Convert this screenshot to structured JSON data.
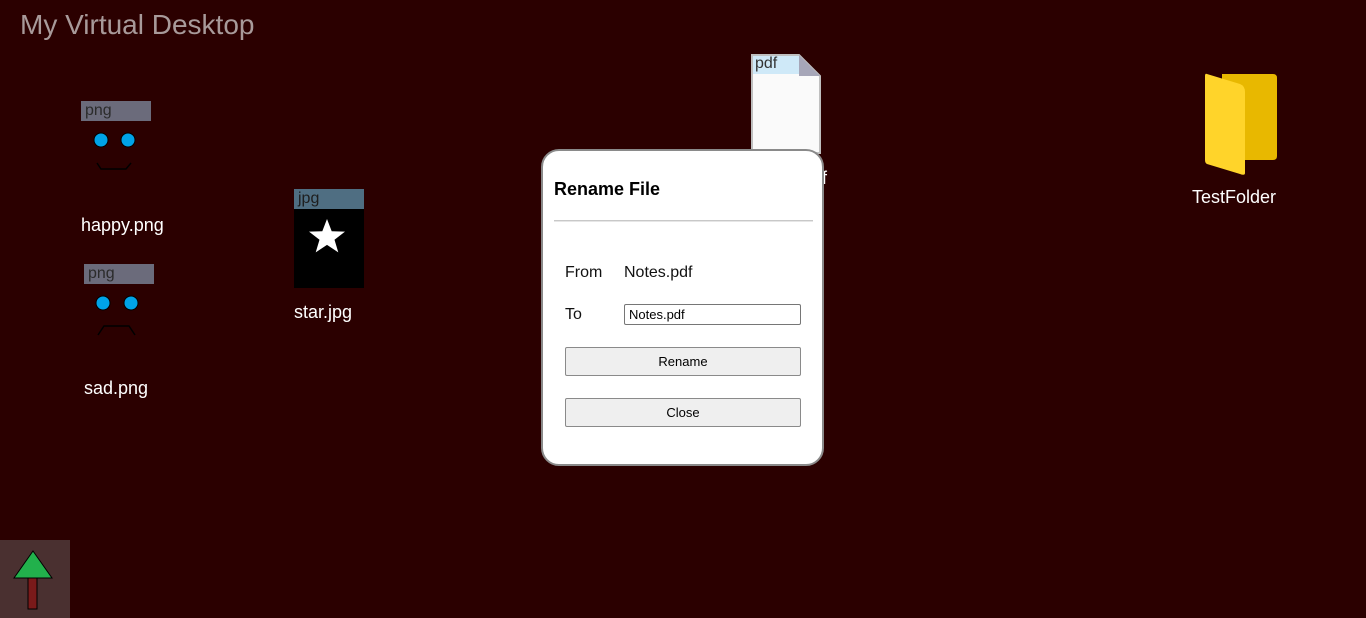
{
  "desktop": {
    "title": "My Virtual Desktop"
  },
  "icons": {
    "happy": {
      "ext": "png",
      "label": "happy.png",
      "icon": "happy-face-icon"
    },
    "sad": {
      "ext": "png",
      "label": "sad.png",
      "icon": "sad-face-icon"
    },
    "star": {
      "ext": "jpg",
      "label": "star.jpg",
      "icon": "star-icon"
    },
    "notes": {
      "ext": "pdf",
      "label_tail": "f",
      "icon": "pdf-document-icon"
    },
    "folder": {
      "label": "TestFolder",
      "icon": "folder-icon"
    }
  },
  "dialog": {
    "title": "Rename File",
    "from_label": "From",
    "from_value": "Notes.pdf",
    "to_label": "To",
    "to_value": "Notes.pdf",
    "rename_button": "Rename",
    "close_button": "Close"
  },
  "taskbar": {
    "up_icon": "up-arrow-icon"
  },
  "colors": {
    "background": "#2b0000",
    "png_tag": "#6b6b7b",
    "jpg_tag": "#4f6e82",
    "pdf_tag": "#cfe9f8",
    "eye": "#00a3e8",
    "folder": "#ffd42a",
    "arrow": "#22b14c"
  }
}
